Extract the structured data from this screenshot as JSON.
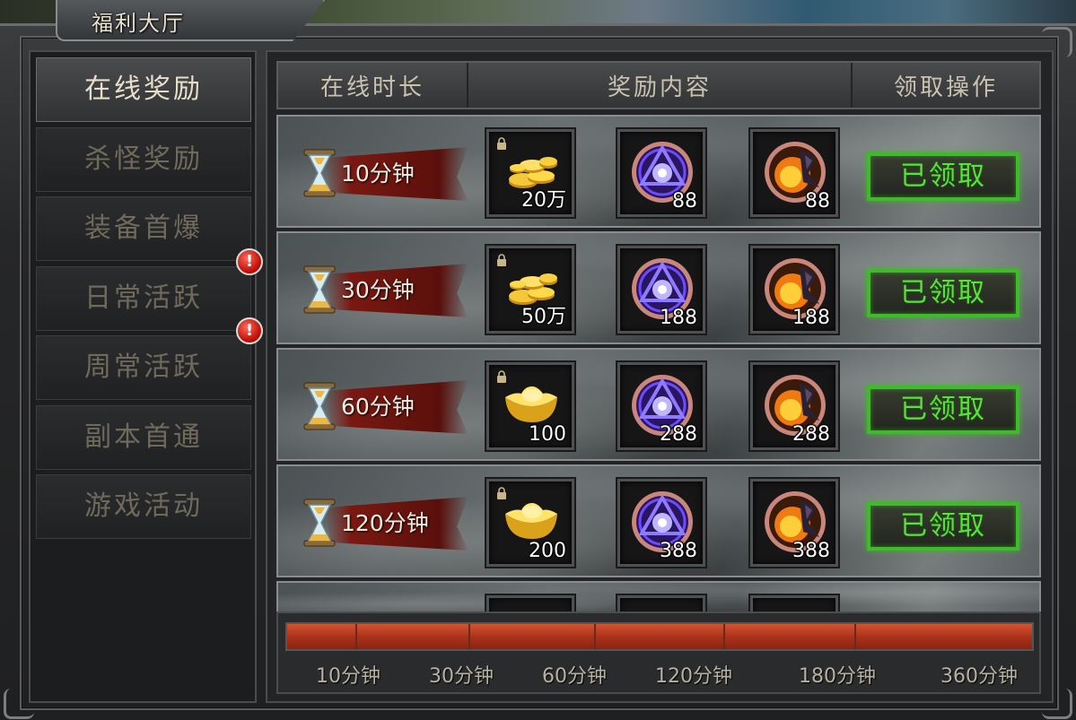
{
  "window": {
    "title": "福利大厅"
  },
  "sidebar": {
    "items": [
      {
        "label": "在线奖励",
        "active": true,
        "badge": false
      },
      {
        "label": "杀怪奖励",
        "active": false,
        "badge": false
      },
      {
        "label": "装备首爆",
        "active": false,
        "badge": false
      },
      {
        "label": "日常活跃",
        "active": false,
        "badge": true
      },
      {
        "label": "周常活跃",
        "active": false,
        "badge": true
      },
      {
        "label": "副本首通",
        "active": false,
        "badge": false
      },
      {
        "label": "游戏活动",
        "active": false,
        "badge": false
      }
    ],
    "badge_text": "!"
  },
  "table": {
    "headers": {
      "duration": "在线时长",
      "rewards": "奖励内容",
      "action": "领取操作"
    },
    "rows": [
      {
        "duration": "10分钟",
        "rewards": [
          {
            "icon": "gold-coins-icon",
            "qty": "20万",
            "locked": true
          },
          {
            "icon": "purple-rune-icon",
            "qty": "88"
          },
          {
            "icon": "fire-orb-icon",
            "qty": "88"
          }
        ],
        "action": "已领取"
      },
      {
        "duration": "30分钟",
        "rewards": [
          {
            "icon": "gold-coins-icon",
            "qty": "50万",
            "locked": true
          },
          {
            "icon": "purple-rune-icon",
            "qty": "188"
          },
          {
            "icon": "fire-orb-icon",
            "qty": "188"
          }
        ],
        "action": "已领取"
      },
      {
        "duration": "60分钟",
        "rewards": [
          {
            "icon": "gold-ingot-icon",
            "qty": "100",
            "locked": true
          },
          {
            "icon": "purple-rune-icon",
            "qty": "288"
          },
          {
            "icon": "fire-orb-icon",
            "qty": "288"
          }
        ],
        "action": "已领取"
      },
      {
        "duration": "120分钟",
        "rewards": [
          {
            "icon": "gold-ingot-icon",
            "qty": "200",
            "locked": true
          },
          {
            "icon": "purple-rune-icon",
            "qty": "388"
          },
          {
            "icon": "fire-orb-icon",
            "qty": "388"
          }
        ],
        "action": "已领取"
      }
    ]
  },
  "progress": {
    "milestones": [
      "10分钟",
      "30分钟",
      "60分钟",
      "120分钟",
      "180分钟",
      "360分钟"
    ],
    "fill_fraction": 1.0
  },
  "colors": {
    "claimed_green": "#5ae13b",
    "progress_red": "#b8391f",
    "badge_red": "#c4140c"
  }
}
